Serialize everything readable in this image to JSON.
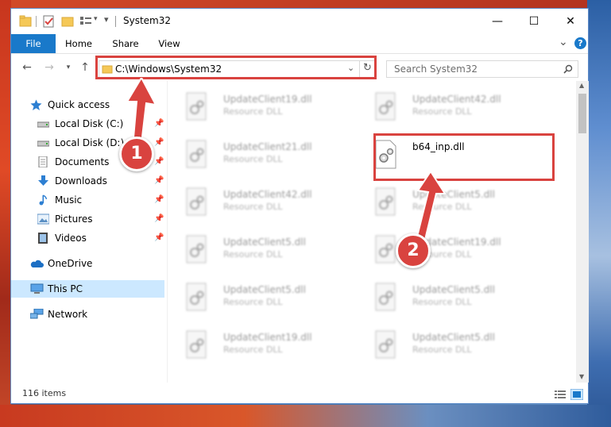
{
  "window": {
    "title": "System32",
    "controls": {
      "minimize": "—",
      "maximize": "☐",
      "close": "✕"
    }
  },
  "ribbon": {
    "tabs": [
      "File",
      "Home",
      "Share",
      "View"
    ],
    "collapse_glyph": "⌄",
    "help_glyph": "?"
  },
  "address": {
    "path": "C:\\Windows\\System32",
    "search_placeholder": "Search System32",
    "icons": [
      "back-arrow-icon",
      "forward-arrow-icon",
      "recent-dropdown-icon",
      "up-arrow-icon",
      "folder-icon",
      "refresh-icon",
      "search-icon"
    ]
  },
  "nav": {
    "items": [
      {
        "label": "Quick access",
        "icon": "star-icon",
        "pinned": false
      },
      {
        "label": "Local Disk (C:)",
        "icon": "drive-icon",
        "pinned": true
      },
      {
        "label": "Local Disk (D:)",
        "icon": "drive-icon",
        "pinned": true
      },
      {
        "label": "Documents",
        "icon": "documents-icon",
        "pinned": true
      },
      {
        "label": "Downloads",
        "icon": "download-icon",
        "pinned": true
      },
      {
        "label": "Music",
        "icon": "music-icon",
        "pinned": true
      },
      {
        "label": "Pictures",
        "icon": "pictures-icon",
        "pinned": true
      },
      {
        "label": "Videos",
        "icon": "videos-icon",
        "pinned": true
      },
      {
        "label": "OneDrive",
        "icon": "cloud-icon",
        "pinned": false
      },
      {
        "label": "This PC",
        "icon": "computer-icon",
        "pinned": false,
        "selected": true
      },
      {
        "label": "Network",
        "icon": "network-icon",
        "pinned": false
      }
    ]
  },
  "files": {
    "left": [
      {
        "name": "UpdateClient19.dll",
        "type": "Resource DLL"
      },
      {
        "name": "UpdateClient21.dll",
        "type": "Resource DLL"
      },
      {
        "name": "UpdateClient42.dll",
        "type": "Resource DLL"
      },
      {
        "name": "UpdateClient5.dll",
        "type": "Resource DLL"
      },
      {
        "name": "UpdateClient5.dll",
        "type": "Resource DLL"
      },
      {
        "name": "UpdateClient19.dll",
        "type": "Resource DLL"
      }
    ],
    "right": [
      {
        "name": "UpdateClient42.dll",
        "type": "Resource DLL"
      },
      {
        "name": "b64_inp.dll",
        "type": "",
        "highlighted": true
      },
      {
        "name": "UpdateClient5.dll",
        "type": "Resource DLL"
      },
      {
        "name": "UpdateClient19.dll",
        "type": "Resource DLL"
      },
      {
        "name": "UpdateClient5.dll",
        "type": "Resource DLL"
      },
      {
        "name": "UpdateClient5.dll",
        "type": "Resource DLL"
      }
    ]
  },
  "status": {
    "item_count": "116 items"
  },
  "annotations": {
    "step1": "1",
    "step2": "2",
    "color": "#d9433f"
  },
  "colors": {
    "accent": "#1979ca",
    "selection": "#cce8ff"
  }
}
